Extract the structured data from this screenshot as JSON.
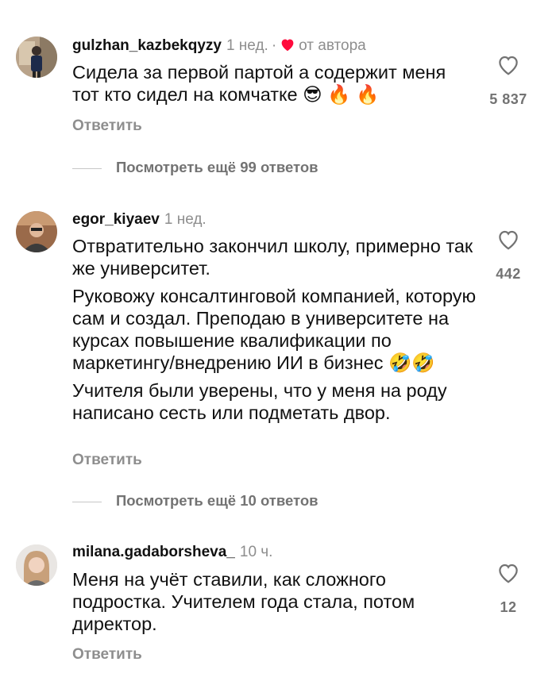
{
  "comments": [
    {
      "username": "gulzhan_kazbekqyzy",
      "time": "1 нед.",
      "dot": "·",
      "author_badge": "от автора",
      "paragraphs": [
        "Сидела за первой партой а содержит меня тот кто сидел на комчатке 😎 🔥 🔥"
      ],
      "likes": "5 837",
      "reply_label": "Ответить",
      "more_replies": "Посмотреть ещё 99 ответов",
      "icon": "heart-outline-icon"
    },
    {
      "username": "egor_kiyaev",
      "time": "1 нед.",
      "paragraphs": [
        "Отвратительно закончил школу, примерно так же университет.",
        "Руковожу консалтинговой компанией, которую сам и создал. Преподаю в университете на курсах повышение квалификации по маркетингу/внедрению ИИ в бизнес 🤣🤣",
        "Учителя были уверены, что у меня на роду написано сесть или подметать двор."
      ],
      "likes": "442",
      "reply_label": "Ответить",
      "more_replies": "Посмотреть ещё 10 ответов",
      "icon": "heart-outline-icon"
    },
    {
      "username": "milana.gadaborsheva_",
      "time": "10 ч.",
      "paragraphs": [
        "Меня на учёт ставили, как сложного подростка. Учителем года стала, потом директор."
      ],
      "likes": "12",
      "reply_label": "Ответить",
      "icon": "heart-outline-icon"
    }
  ],
  "colors": {
    "text": "#111111",
    "muted": "#8e8e8e",
    "author_heart": "#ff0a3c"
  }
}
